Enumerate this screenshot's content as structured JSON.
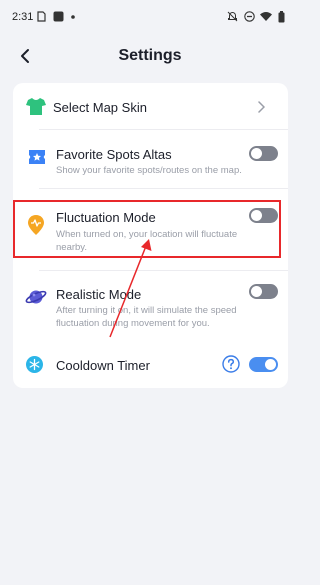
{
  "status_bar": {
    "time": "2:31",
    "left_icons": [
      "sim-icon",
      "square-app-icon",
      "dot-icon"
    ],
    "right_icons": [
      "alarm-off-icon",
      "do-not-disturb-icon",
      "wifi-icon",
      "battery-icon"
    ]
  },
  "header": {
    "title": "Settings",
    "back_icon": "chevron-left-icon"
  },
  "settings": {
    "map_skin": {
      "title": "Select Map Skin",
      "icon": "shirt-icon",
      "icon_color": "#2ec27e",
      "action_icon": "chevron-right-icon"
    },
    "favorite_spots": {
      "title": "Favorite Spots Altas",
      "description": "Show your favorite spots/routes on the map.",
      "icon": "star-ticket-icon",
      "icon_color": "#3b82f6",
      "enabled": false
    },
    "fluctuation_mode": {
      "title": "Fluctuation Mode",
      "description_line1": "When turned on, your location will fluctuate",
      "description_line2": "nearby.",
      "icon": "location-pulse-icon",
      "icon_color": "#f5a623",
      "enabled": false,
      "highlighted": true
    },
    "realistic_mode": {
      "title": "Realistic Mode",
      "description_line1": "After turning it on, it will simulate the speed",
      "description_line2": "fluctuation during movement for you.",
      "icon": "planet-icon",
      "icon_color": "#5b5bd6",
      "enabled": false
    },
    "cooldown_timer": {
      "title": "Cooldown Timer",
      "icon": "snowflake-icon",
      "icon_color": "#2bb5e8",
      "help_icon": "question-circle-icon",
      "enabled": true
    }
  },
  "colors": {
    "background": "#f2f3f7",
    "card": "#ffffff",
    "toggle_off": "#7d818c",
    "toggle_on": "#4a8ef0",
    "annotation_red": "#e8282b"
  }
}
